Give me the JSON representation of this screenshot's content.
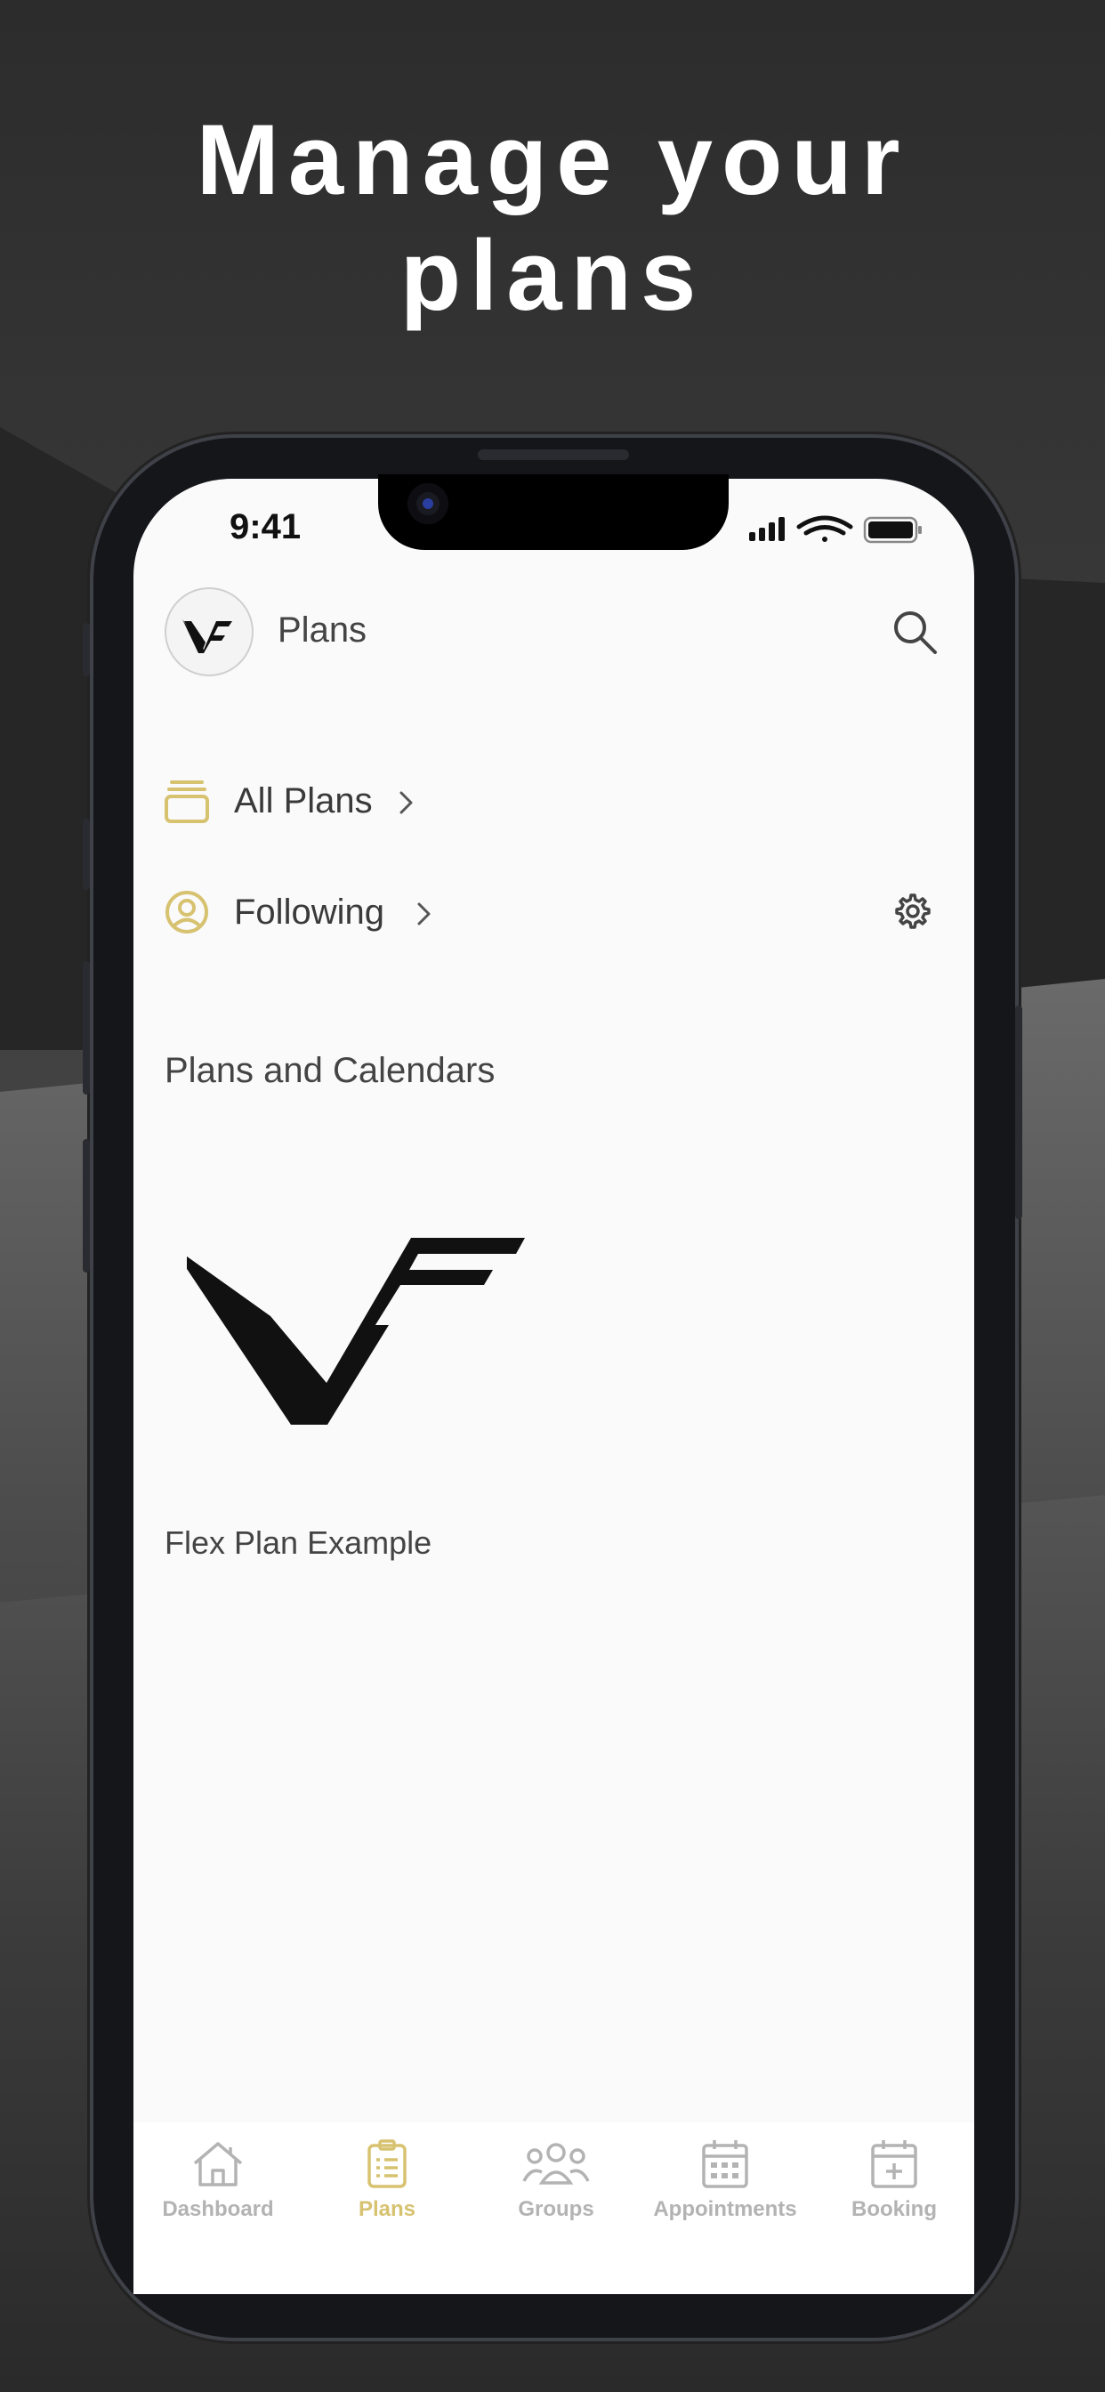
{
  "marketing": {
    "headline_line1": "Manage your",
    "headline_line2": "plans"
  },
  "status_bar": {
    "time": "9:41",
    "icons": [
      "cellular-signal-icon",
      "wifi-icon",
      "battery-icon"
    ]
  },
  "header": {
    "title": "Plans",
    "avatar_icon": "vf-logo-icon",
    "search_icon": "search-icon"
  },
  "nav_rows": [
    {
      "label": "All Plans",
      "icon": "stack-icon"
    },
    {
      "label": "Following",
      "icon": "user-circle-icon"
    }
  ],
  "settings_icon": "gear-icon",
  "section": {
    "title": "Plans and Calendars"
  },
  "plans": [
    {
      "name": "Flex Plan Example",
      "logo": "vf-logo-icon"
    }
  ],
  "tab_bar": {
    "items": [
      {
        "label": "Dashboard",
        "icon": "home-icon",
        "active": false
      },
      {
        "label": "Plans",
        "icon": "clipboard-icon",
        "active": true
      },
      {
        "label": "Groups",
        "icon": "group-icon",
        "active": false
      },
      {
        "label": "Appointments",
        "icon": "calendar-icon",
        "active": false
      },
      {
        "label": "Booking",
        "icon": "calendar-plus-icon",
        "active": false
      }
    ]
  },
  "colors": {
    "accent": "#D7C270",
    "inactive_tab": "#B3B3B3",
    "screen_background": "#FAFAFA"
  }
}
